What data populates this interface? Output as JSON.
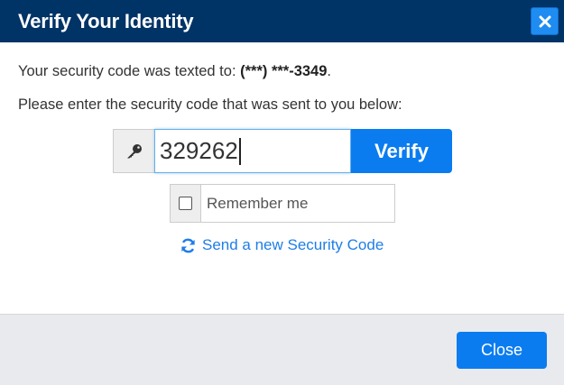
{
  "dialog": {
    "title": "Verify Your Identity",
    "close_icon": "close-x-icon"
  },
  "message": {
    "texted_prefix": "Your security code was texted to: ",
    "phone_masked": "(***) ***-3349",
    "texted_suffix": ".",
    "instruction": "Please enter the security code that was sent to you below:"
  },
  "code_form": {
    "key_icon": "key-icon",
    "code_value": "329262",
    "verify_label": "Verify"
  },
  "remember": {
    "checked": false,
    "label": "Remember me"
  },
  "resend": {
    "icon": "refresh-icon",
    "label": "Send a new Security Code"
  },
  "footer": {
    "close_label": "Close"
  },
  "colors": {
    "header_bg": "#003366",
    "primary_button": "#0a7cf0",
    "link": "#1e7ee8",
    "footer_bg": "#e9eaed"
  }
}
